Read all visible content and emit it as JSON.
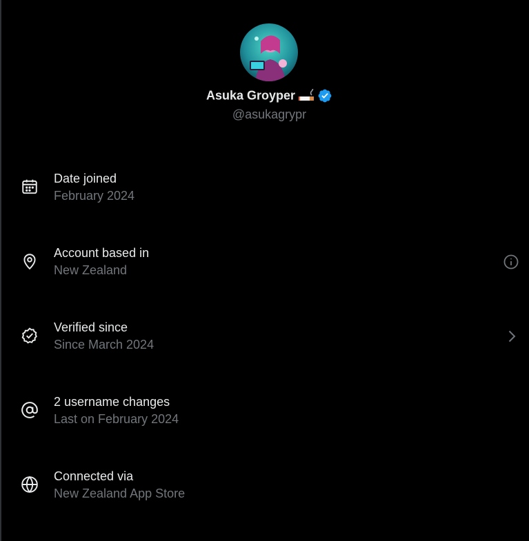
{
  "profile": {
    "display_name": "Asuka Groyper",
    "handle": "@asukagrypr",
    "verified": true,
    "name_emoji": "cigarette-emoji"
  },
  "colors": {
    "background": "#000000",
    "primary_text": "#e7e9ea",
    "secondary_text": "#71767b",
    "verified_blue": "#1d9bf0"
  },
  "rows": [
    {
      "icon": "calendar-icon",
      "title": "Date joined",
      "subtitle": "February 2024",
      "action": null
    },
    {
      "icon": "location-pin-icon",
      "title": "Account based in",
      "subtitle": "New Zealand",
      "action": "info-icon"
    },
    {
      "icon": "verified-check-icon",
      "title": "Verified since",
      "subtitle": "Since March 2024",
      "action": "chevron-right-icon"
    },
    {
      "icon": "at-sign-icon",
      "title": "2 username changes",
      "subtitle": "Last on February 2024",
      "action": null
    },
    {
      "icon": "globe-icon",
      "title": "Connected via",
      "subtitle": "New Zealand App Store",
      "action": null
    }
  ]
}
